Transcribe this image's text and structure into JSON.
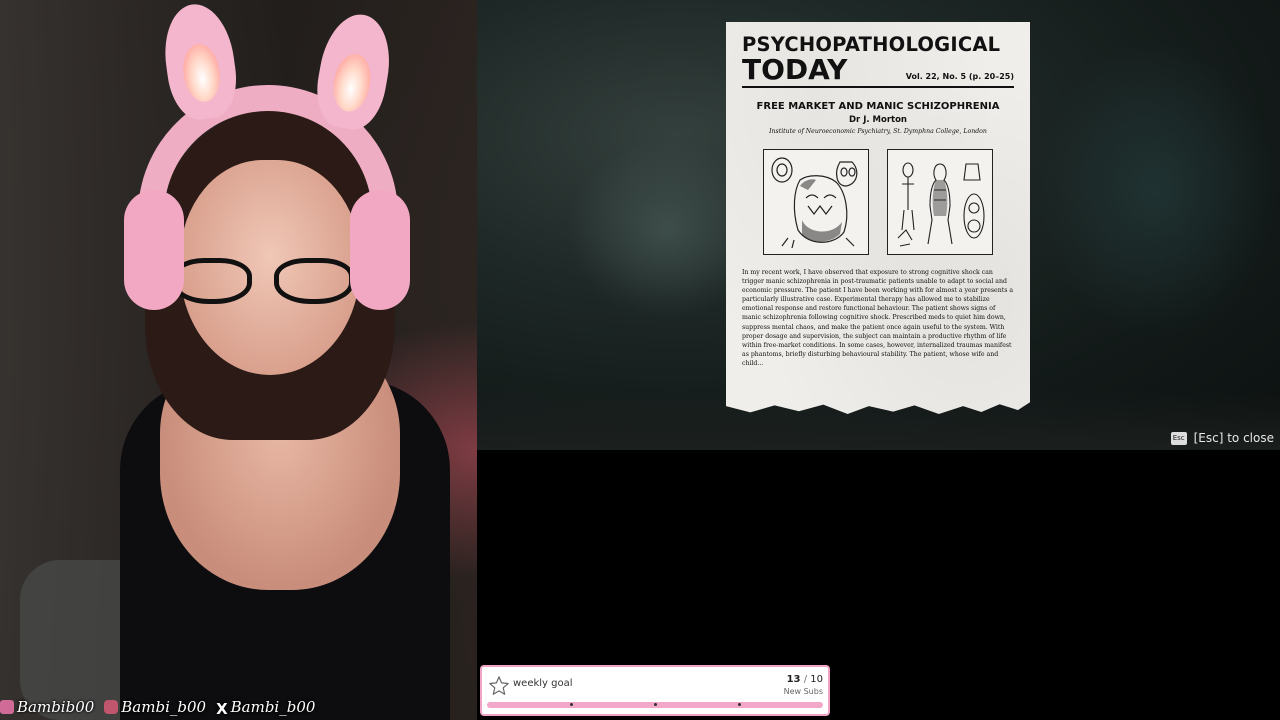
{
  "socials": [
    {
      "platform": "twitch",
      "icon": "twitch-icon",
      "handle": "Bambib00"
    },
    {
      "platform": "instagram",
      "icon": "instagram-icon",
      "handle": "Bambi_b00"
    },
    {
      "platform": "x",
      "icon": "x-icon",
      "glyph": "X",
      "handle": "Bambi_b00"
    }
  ],
  "journal": {
    "masthead_line1": "PSYCHOPATHOLOGICAL",
    "masthead_line2": "TODAY",
    "volume": "Vol. 22, No. 5 (p. 20–25)",
    "headline": "FREE MARKET AND MANIC SCHIZOPHRENIA",
    "author": "Dr J. Morton",
    "institution": "Institute of Neuroeconomic Psychiatry, St. Dymphna College, London",
    "body": "In my recent work, I have observed that exposure to strong cognitive shock can trigger manic schizophrenia in post-traumatic patients unable to adapt to social and economic pressure. The patient I have been working with for almost a year presents a particularly illustrative case. Experimental therapy has allowed me to stabilize emotional response and restore functional behaviour. The patient shows signs of manic schizophrenia following cognitive shock. Prescribed meds to quiet him down, suppress mental chaos, and make the patient once again useful to the system. With proper dosage and supervision, the subject can maintain a productive rhythm of life within free-market conditions. In some cases, however, internalized traumas manifest as phantoms, briefly disturbing behavioural stability. The patient, whose wife and child..."
  },
  "close_hint": {
    "key": "Esc",
    "label": "[Esc] to close"
  },
  "weekly_goal": {
    "label": "weekly goal",
    "current": "13",
    "separator": "/",
    "target": "10",
    "unit": "New Subs",
    "progress": 1.0,
    "colors": {
      "border": "#f0a3c5",
      "bar": "#f3a7c9"
    }
  }
}
